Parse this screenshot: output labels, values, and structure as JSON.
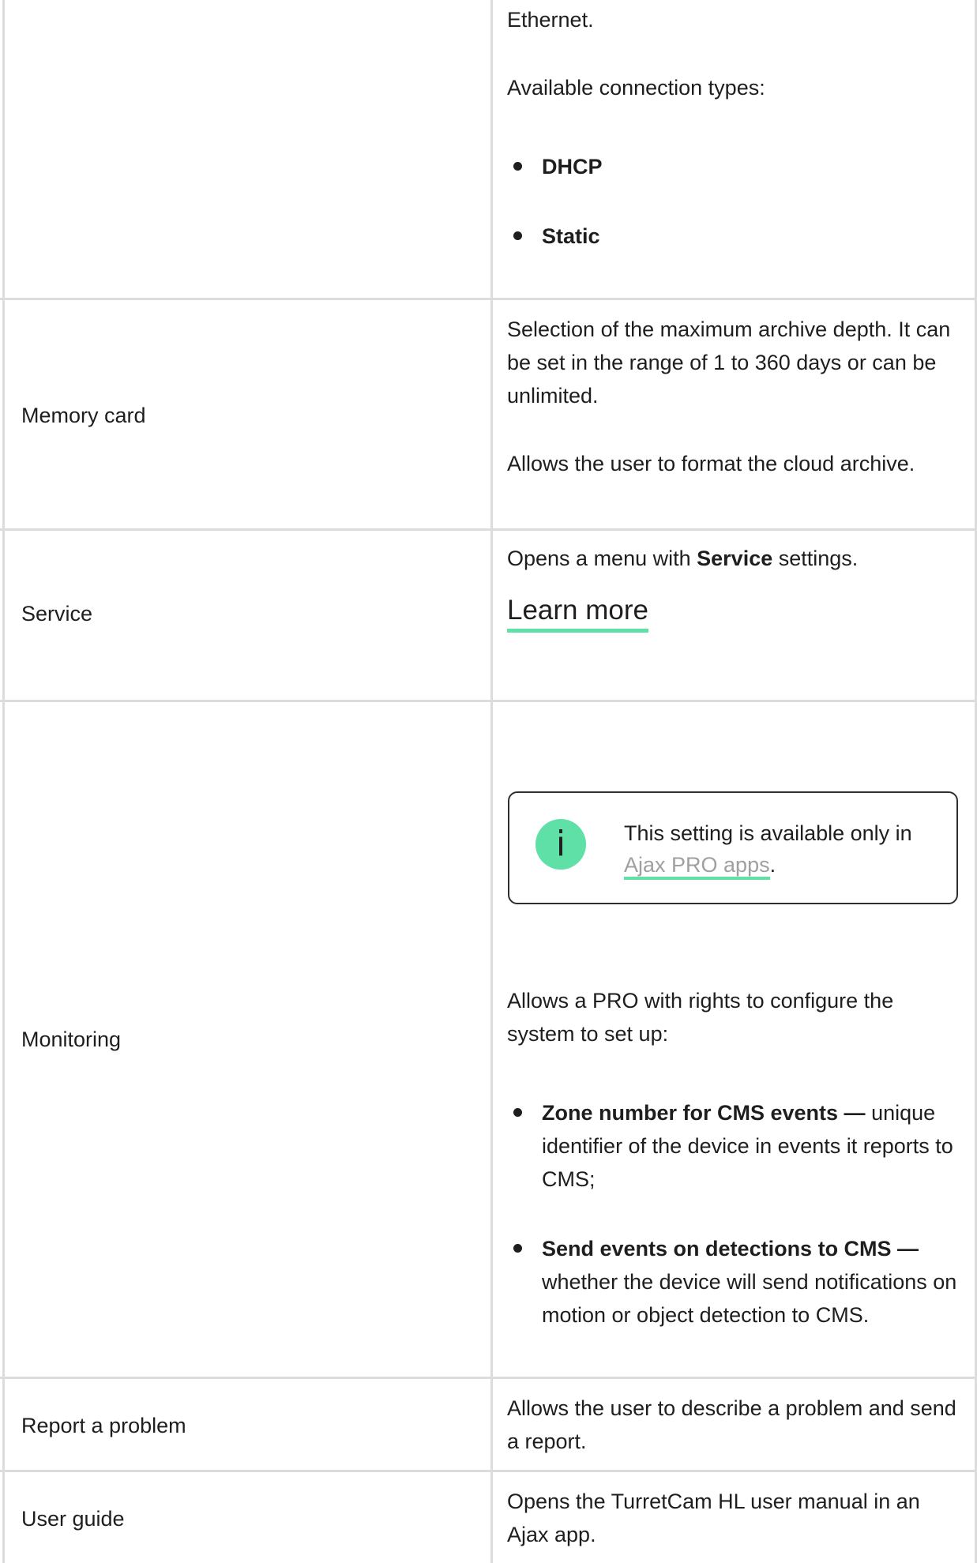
{
  "rows": [
    {
      "label": "",
      "continued_text": "Ethernet.",
      "intro": "Available connection types:",
      "bullets": [
        "DHCP",
        "Static"
      ]
    },
    {
      "label": "Memory card",
      "paragraph1": "Selection of the maximum archive depth. It can be set in the range of 1 to 360 days or can be unlimited.",
      "paragraph2": "Allows the user to format the cloud archive."
    },
    {
      "label": "Service",
      "text_before": "Opens a menu with ",
      "text_bold": "Service",
      "text_after": " settings.",
      "link": "Learn more"
    },
    {
      "label": "Monitoring",
      "notice_text": "This setting is available only in ",
      "notice_link": "Ajax PRO apps",
      "notice_suffix": ".",
      "intro": "Allows a PRO with rights to configure the system to set up:",
      "bullets": [
        {
          "title": "Zone number for CMS events —",
          "text": " unique identifier of the device in events it reports to CMS;"
        },
        {
          "title": "Send events on detections to CMS —",
          "text": " whether the device will send notifications on motion or object detection to CMS."
        }
      ]
    },
    {
      "label": "Report a problem",
      "text": "Allows the user to describe a problem and send a report."
    },
    {
      "label": "User guide",
      "text": "Opens the TurretCam HL user manual in an Ajax app."
    }
  ],
  "icons": {
    "notice_icon": "info-icon",
    "notice_icon_glyph": "i"
  },
  "colors": {
    "accent": "#5ee0a6",
    "border": "#dcdcdc",
    "text": "#1e1e1e",
    "link_muted": "#a0a0a0"
  }
}
